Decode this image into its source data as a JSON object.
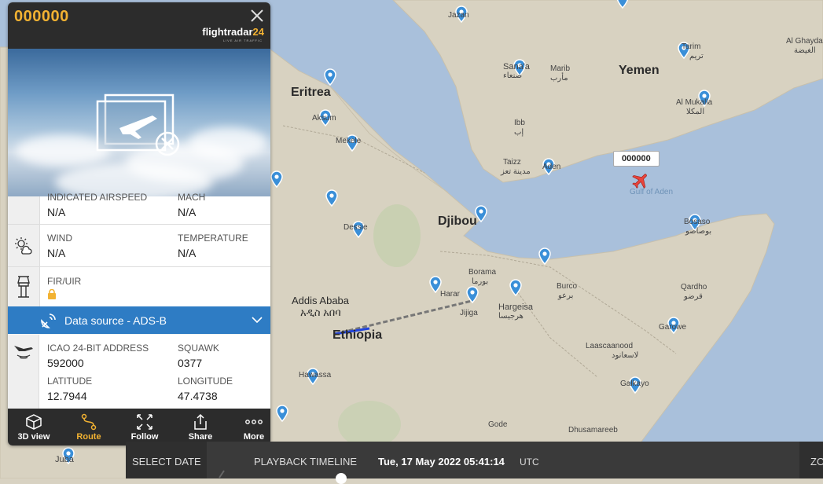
{
  "map": {
    "countries": [
      {
        "key": "eritrea",
        "text": "Eritrea"
      },
      {
        "key": "yemen",
        "text": "Yemen"
      },
      {
        "key": "djibouti",
        "text": "Djibou"
      },
      {
        "key": "ethiopia",
        "text": "Ethiopia"
      }
    ],
    "cities": {
      "jazan": "Jazan",
      "sanaa": "Sana'a",
      "sanaa_ar": "صنعاء",
      "marib": "Marib",
      "marib_ar": "مأرب",
      "tarim": "Tarim",
      "tarim_ar": "تريم",
      "al_ghayda": "Al Ghayda",
      "al_ghayda_ar": "الغيضة",
      "al_mukalla": "Al Mukalla",
      "al_mukalla_ar": "المكلا",
      "ibb": "Ibb",
      "ibb_ar": "إب",
      "taizz": "Taizz",
      "taizz_ar": "مدينة تعز",
      "aden": "Aden",
      "aksum": "Aksum",
      "mekele": "Mekele",
      "dessie": "Dessie",
      "borama": "Borama",
      "borama_ar": "بورما",
      "harar": "Harar",
      "jijiga": "Jijiga",
      "hargeisa": "Hargeisa",
      "hargeisa_ar": "هرجيسا",
      "burco": "Burco",
      "burco_ar": "برعو",
      "bosaso": "Bosaso",
      "bosaso_ar": "بوصاصو",
      "qardho": "Qardho",
      "qardho_ar": "قرضو",
      "garowe": "Garowe",
      "laascaanood": "Laascaanood",
      "laascaanood_ar": "لاسعانود",
      "addis": "Addis Ababa",
      "addis_am": "አዲስ አበባ",
      "hawassa": "Hawassa",
      "galkayo": "Galkayo",
      "gode": "Gode",
      "dhusamareeb": "Dhusamareeb",
      "juba": "Juba"
    },
    "sea_label": "Gulf of Aden",
    "aircraft_label": "000000",
    "colors": {
      "land": "#d6d0bf",
      "water": "#a9c0db",
      "route": "#2244dd",
      "pin": "#3a8fd8"
    }
  },
  "panel": {
    "callsign": "000000",
    "close_icon": "close-icon",
    "brand_main": "flightradar",
    "brand_num": "24",
    "brand_sub": "LIVE AIR TRAFFIC",
    "rows": {
      "airspeed": {
        "label1": "INDICATED AIRSPEED",
        "value1": "N/A",
        "label2": "MACH",
        "value2": "N/A"
      },
      "wind": {
        "label1": "WIND",
        "value1": "N/A",
        "label2": "TEMPERATURE",
        "value2": "N/A"
      },
      "fir": {
        "label": "FIR/UIR"
      },
      "datasource": "Data source - ADS-B",
      "icao": {
        "label1": "ICAO 24-BIT ADDRESS",
        "value1": "592000",
        "label2": "SQUAWK",
        "value2": "0377"
      },
      "position": {
        "label1": "LATITUDE",
        "value1": "12.7944",
        "label2": "LONGITUDE",
        "value2": "47.4738"
      }
    },
    "toolbar": [
      {
        "label": "3D view",
        "icon": "cube-icon"
      },
      {
        "label": "Route",
        "icon": "route-icon",
        "active": true
      },
      {
        "label": "Follow",
        "icon": "follow-icon"
      },
      {
        "label": "Share",
        "icon": "share-icon"
      },
      {
        "label": "More",
        "icon": "more-icon"
      }
    ]
  },
  "bottombar": {
    "select_date": "SELECT DATE",
    "playback": "PLAYBACK TIMELINE",
    "time": "Tue, 17 May 2022 05:41:14",
    "tz": "UTC",
    "zoom": "ZO"
  }
}
